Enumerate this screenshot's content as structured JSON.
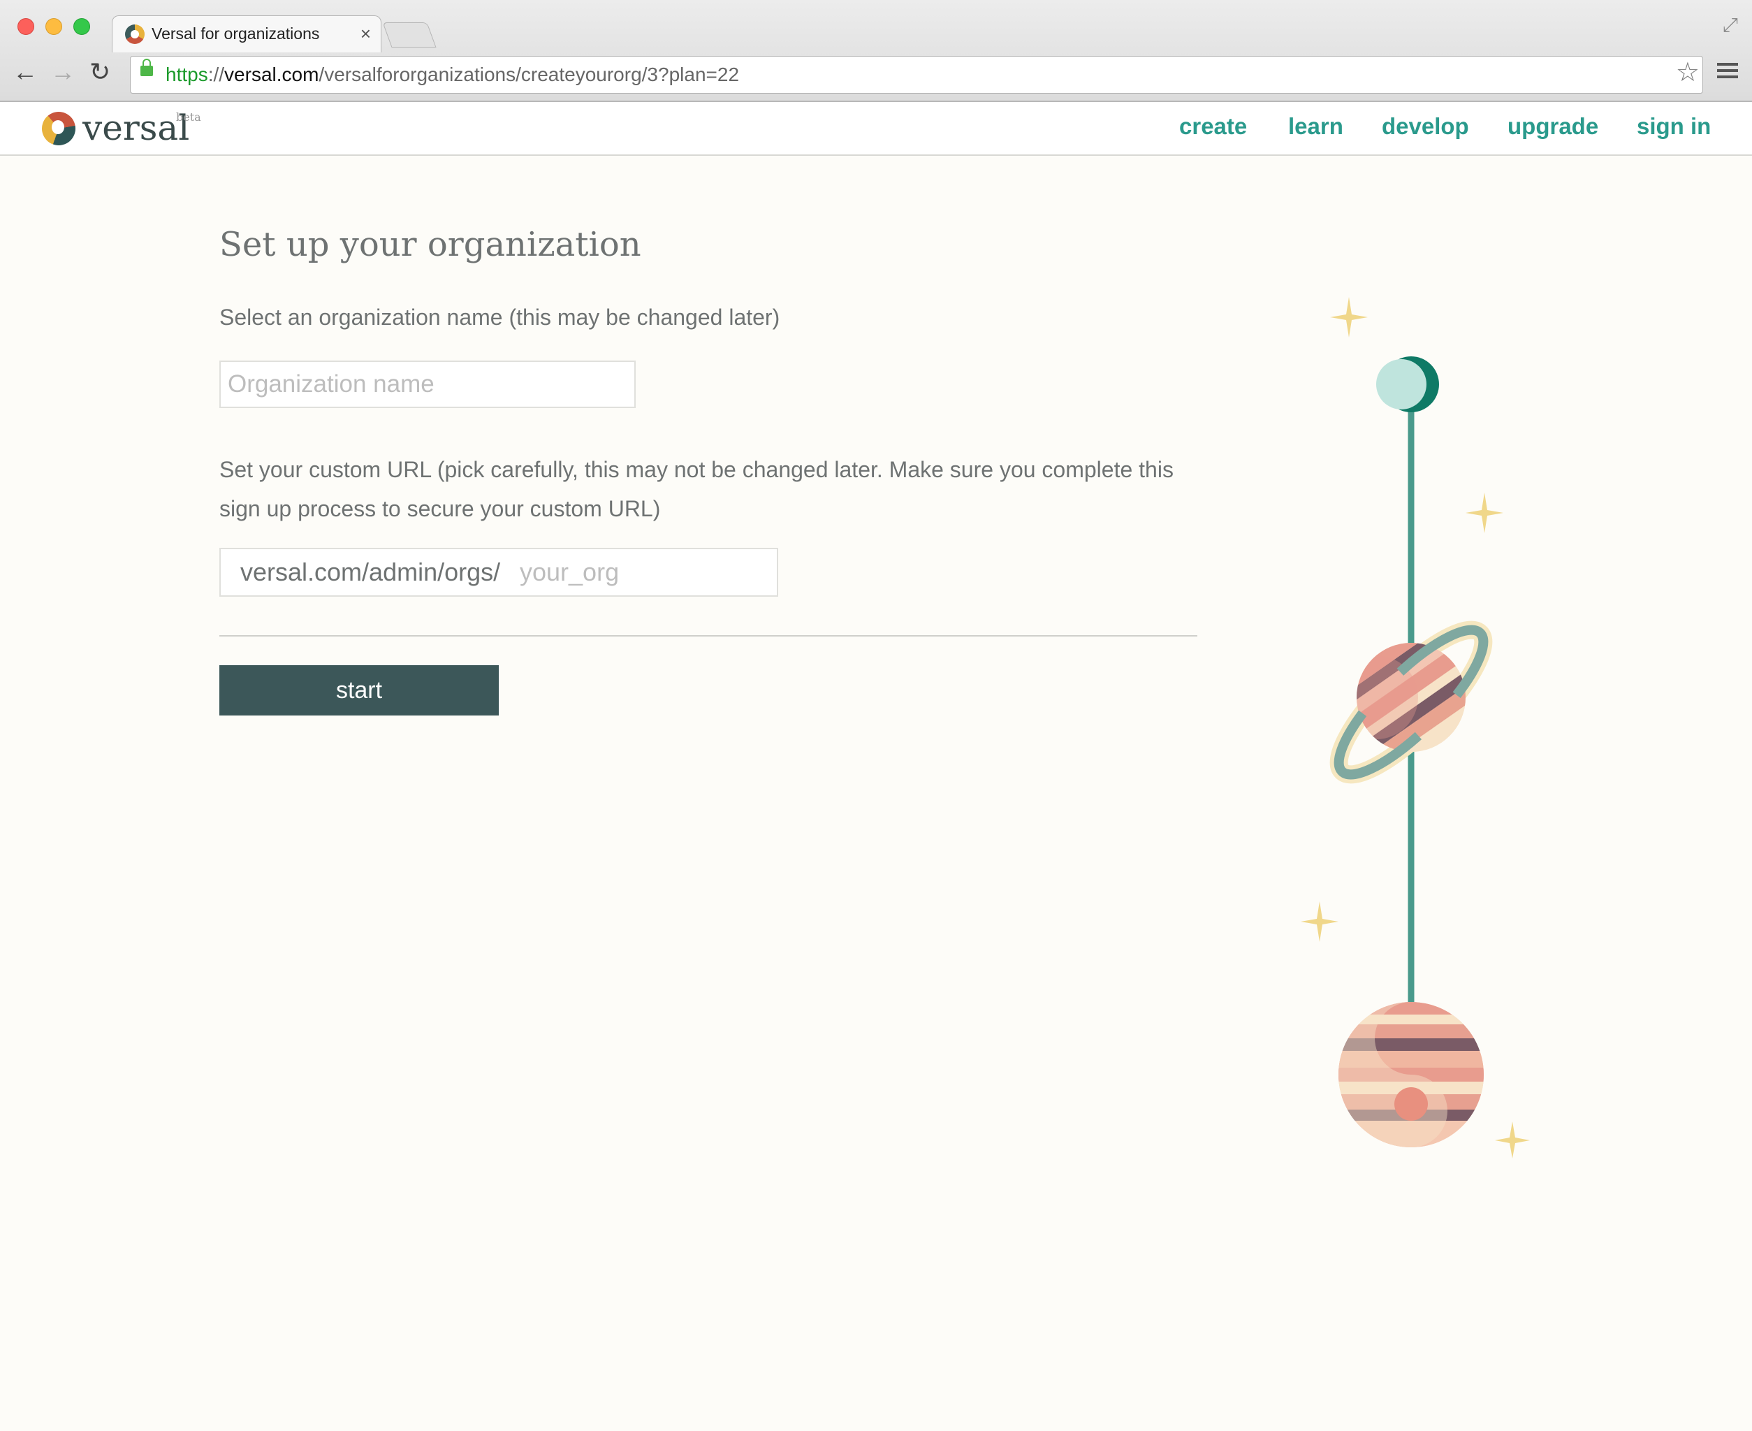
{
  "browser": {
    "tab_title": "Versal for organizations",
    "tab_close": "×",
    "url_scheme": "https",
    "url_sep": "://",
    "url_host": "versal.com",
    "url_path": "/versalfororganizations/createyourorg/3?plan=22",
    "icons": [
      "back-icon",
      "forward-icon",
      "reload-icon",
      "lock-icon",
      "star-icon",
      "menu-icon",
      "fullscreen-icon"
    ]
  },
  "site": {
    "logo_text": "versal",
    "logo_badge": "beta",
    "nav": {
      "create": "create",
      "learn": "learn",
      "develop": "develop",
      "upgrade": "upgrade",
      "sign_in": "sign in"
    },
    "accent_color": "#2a9a8c"
  },
  "form": {
    "title": "Set up your organization",
    "name_label": "Select an organization name (this may be changed later)",
    "name_placeholder": "Organization name",
    "url_label": "Set your custom URL (pick carefully, this may not be changed later. Make sure you complete this sign up process to secure your custom URL)",
    "url_prefix": "versal.com/admin/orgs/",
    "url_placeholder": "your_org",
    "start_label": "start",
    "button_color": "#3c5759"
  }
}
